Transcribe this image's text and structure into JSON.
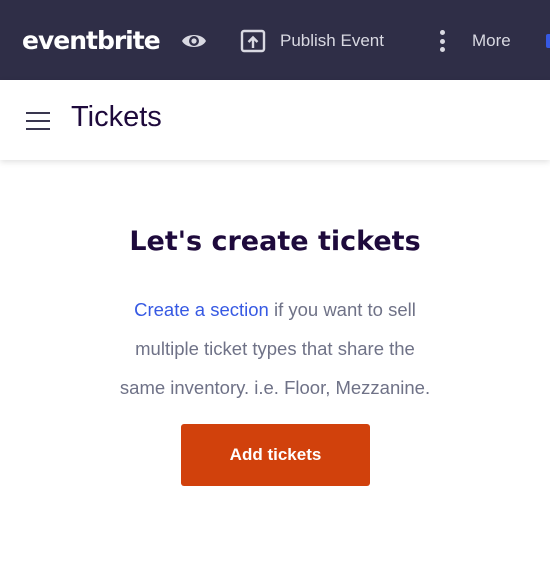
{
  "header": {
    "logo_text": "eventbrite",
    "preview_icon": "eye-icon",
    "publish_icon": "upload-box-icon",
    "publish_label": "Publish Event",
    "more_icon": "kebab-vertical-icon",
    "more_label": "More"
  },
  "subheader": {
    "menu_icon": "hamburger-menu-icon",
    "title": "Tickets"
  },
  "empty_state": {
    "heading": "Let's create tickets",
    "link_text": "Create a section",
    "line1_rest": " if you want to sell",
    "line2": "multiple ticket types that share the",
    "line3": "same inventory. i.e. Floor, Mezzanine.",
    "button_label": "Add tickets"
  },
  "colors": {
    "header_bg": "#2f2e47",
    "title_text": "#1e0a3c",
    "link": "#3659e3",
    "primary_button": "#d1410c",
    "body_text": "#6f7287"
  }
}
